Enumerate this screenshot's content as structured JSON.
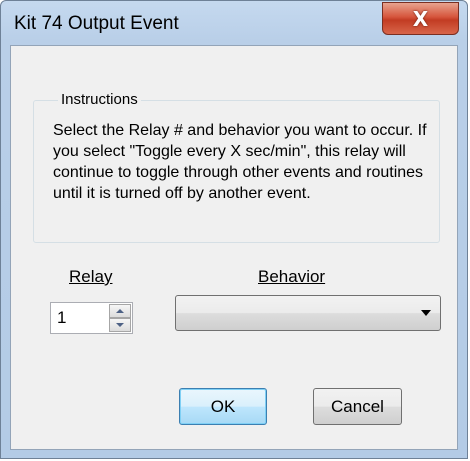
{
  "window": {
    "title": "Kit 74 Output Event",
    "close_label": "X"
  },
  "instructions": {
    "legend": "Instructions",
    "text": "Select the Relay # and behavior you want to occur. If you select \"Toggle every X sec/min\", this relay will continue to toggle through other events and routines until it is turned off by another event."
  },
  "relay": {
    "label": "Relay",
    "value": "1"
  },
  "behavior": {
    "label": "Behavior",
    "selected": ""
  },
  "buttons": {
    "ok": "OK",
    "cancel": "Cancel"
  },
  "icons": {
    "spin_up": "triangle-up-icon",
    "spin_down": "triangle-down-icon",
    "combo_arrow": "chevron-down-icon"
  }
}
